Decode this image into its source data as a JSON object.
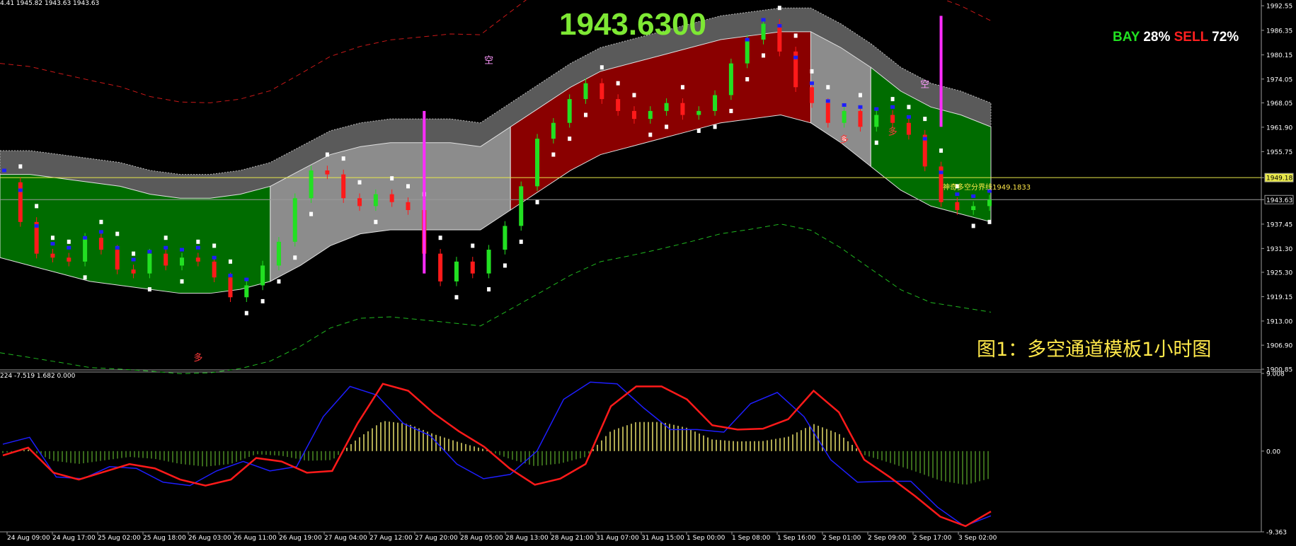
{
  "header": {
    "ohlc_readout": "4.41 1945.82 1943.63 1943.63"
  },
  "overlay": {
    "big_price": "1943.6300",
    "bay_label": "BAY",
    "bay_pct": "28%",
    "sell_label": "SELL",
    "sell_pct": "72%",
    "caption": "图1：多空通道模板1小时图",
    "boundary_label": "神奇多空分界线1949.1833"
  },
  "subpanel": {
    "readout": "224 -7.519 1.682 0.000"
  },
  "colors": {
    "bull": "#22e022",
    "bear": "#ff1a1a",
    "magenta": "#ff2cff",
    "blue": "#1e1eff",
    "green_band": "#006c00",
    "red_band": "#8a0000",
    "gray_band": "#8c8c8c",
    "dark_band": "#5a5a5a",
    "hline": "#e8e84a"
  },
  "chart_data": [
    {
      "type": "candlestick",
      "title": "",
      "y_ticks": [
        "1992.55",
        "1986.35",
        "1980.15",
        "1974.05",
        "1968.05",
        "1961.90",
        "1955.75",
        "1949.18",
        "1943.63",
        "1937.45",
        "1931.30",
        "1925.30",
        "1919.15",
        "1913.00",
        "1906.90",
        "1900.85"
      ],
      "ylim": [
        1900.85,
        1994
      ],
      "x_ticks": [
        "24 Aug 09:00",
        "24 Aug 17:00",
        "25 Aug 02:00",
        "25 Aug 18:00",
        "26 Aug 03:00",
        "26 Aug 11:00",
        "26 Aug 19:00",
        "27 Aug 04:00",
        "27 Aug 12:00",
        "27 Aug 20:00",
        "28 Aug 05:00",
        "28 Aug 13:00",
        "28 Aug 21:00",
        "31 Aug 07:00",
        "31 Aug 15:00",
        "1 Sep 00:00",
        "1 Sep 08:00",
        "1 Sep 16:00",
        "2 Sep 01:00",
        "2 Sep 09:00",
        "2 Sep 17:00",
        "3 Sep 02:00"
      ],
      "current_price": 1943.63,
      "boundary_level": 1949.18,
      "markers": [
        "多",
        "多",
        "多",
        "空",
        "空"
      ],
      "close_path": [
        1948,
        1938,
        1930,
        1929,
        1928,
        1934,
        1931,
        1926,
        1925,
        1930,
        1927,
        1929,
        1928,
        1924,
        1919,
        1922,
        1927,
        1933,
        1944,
        1951,
        1950,
        1944,
        1942,
        1945,
        1943,
        1941,
        1930,
        1923,
        1928,
        1925,
        1931,
        1937,
        1947,
        1959,
        1963,
        1969,
        1973,
        1969,
        1966,
        1964,
        1966,
        1968,
        1965,
        1966,
        1970,
        1978,
        1984,
        1988,
        1981,
        1972,
        1968,
        1963,
        1966,
        1962,
        1965,
        1963,
        1960,
        1952,
        1943,
        1941,
        1942,
        1943.63
      ],
      "upper_band": [
        1950,
        1950,
        1949,
        1948,
        1947,
        1945,
        1944,
        1944,
        1945,
        1947,
        1951,
        1955,
        1957,
        1958,
        1958,
        1958,
        1957,
        1962,
        1967,
        1972,
        1976,
        1978,
        1980,
        1982,
        1984,
        1985,
        1986,
        1986,
        1982,
        1977,
        1971,
        1967,
        1965,
        1962
      ],
      "lower_band": [
        1929,
        1927,
        1925,
        1923,
        1922,
        1921,
        1920,
        1920,
        1921,
        1923,
        1927,
        1932,
        1935,
        1936,
        1936,
        1936,
        1936,
        1941,
        1946,
        1951,
        1955,
        1957,
        1959,
        1961,
        1963,
        1964,
        1965,
        1963,
        1958,
        1952,
        1946,
        1942,
        1940,
        1938
      ]
    },
    {
      "type": "line",
      "title": "",
      "y_ticks": [
        "9.008",
        "0.00",
        "-9.363"
      ],
      "ylim": [
        -9.363,
        9.008
      ],
      "series": [
        {
          "name": "",
          "values": [
            -0.5,
            0.4,
            -2.5,
            -3.3,
            -2.4,
            -1.5,
            -2.0,
            -3.3,
            -4.0,
            -3.3,
            -0.8,
            -1.2,
            -2.5,
            -2.3,
            3.2,
            7.8,
            7.0,
            4.4,
            2.3,
            0.5,
            -2.0,
            -3.9,
            -3.2,
            -1.5,
            5.2,
            7.5,
            7.5,
            6.0,
            3.0,
            2.5,
            2.6,
            3.7,
            7.0,
            4.5,
            -1.0,
            -3.0,
            -5.2,
            -7.6,
            -8.7,
            -7.0
          ]
        },
        {
          "name": "",
          "values": [
            0.8,
            1.6,
            -3.0,
            -3.2,
            -1.8,
            -2.0,
            -3.6,
            -4.0,
            -2.3,
            -1.2,
            -2.3,
            -1.8,
            4.0,
            7.5,
            6.5,
            3.2,
            1.8,
            -1.5,
            -3.2,
            -2.7,
            0.0,
            6.0,
            8.0,
            7.8,
            5.0,
            2.5,
            2.5,
            2.2,
            5.5,
            6.8,
            4.0,
            -1.0,
            -3.6,
            -3.5,
            -3.5,
            -6.5,
            -8.7,
            -7.5
          ]
        }
      ]
    }
  ]
}
